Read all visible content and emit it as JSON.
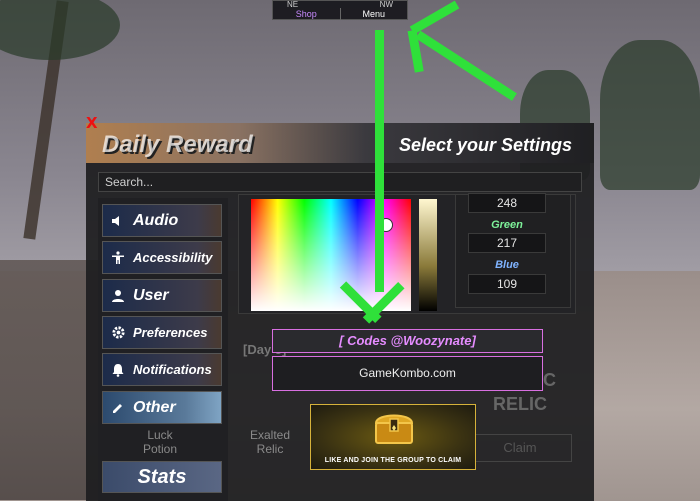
{
  "compass": {
    "dir_left": "NE",
    "dir_right": "NW",
    "tab_shop": "Shop",
    "tab_menu": "Menu"
  },
  "panel": {
    "close": "X",
    "header_left": "Daily Reward",
    "header_right": "Select your Settings",
    "search_placeholder": "Search..."
  },
  "sidebar": {
    "items": [
      {
        "label": "Audio",
        "icon": "speaker-icon"
      },
      {
        "label": "Accessibility",
        "icon": "accessibility-icon"
      },
      {
        "label": "User",
        "icon": "user-icon"
      },
      {
        "label": "Preferences",
        "icon": "gear-icon"
      },
      {
        "label": "Notifications",
        "icon": "bell-icon"
      },
      {
        "label": "Other",
        "icon": "pencil-icon"
      }
    ],
    "stats": "Stats"
  },
  "background": {
    "luck": "Luck Potion",
    "exalted": "Exalted Relic",
    "day5": "[Day 5]",
    "cosmic": "COSMIC RELIC",
    "claim": "Claim"
  },
  "color": {
    "red_value": "248",
    "green_label": "Green",
    "green_value": "217",
    "blue_label": "Blue",
    "blue_value": "109"
  },
  "codes": {
    "title": "[ Codes @Woozynate]",
    "input_value": "GameKombo.com"
  },
  "group": {
    "text": "LIKE AND JOIN THE GROUP TO CLAIM"
  }
}
